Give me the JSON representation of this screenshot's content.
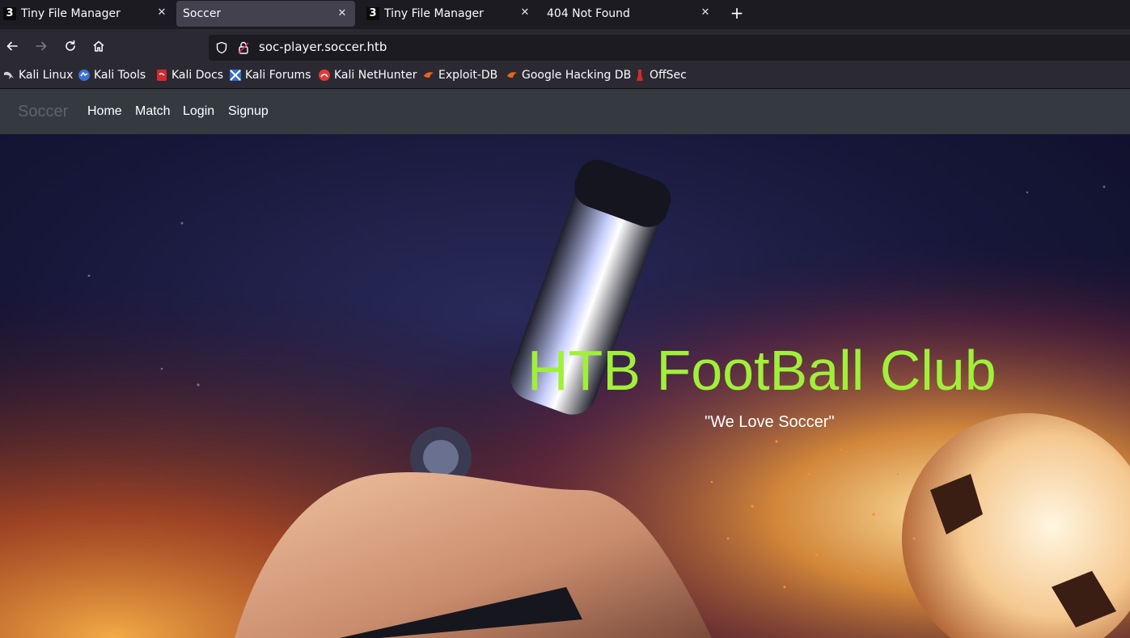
{
  "browser": {
    "tabs": [
      {
        "title": "Tiny File Manager",
        "favicon": "3",
        "active": false
      },
      {
        "title": "Soccer",
        "favicon": "",
        "active": true
      },
      {
        "title": "Tiny File Manager",
        "favicon": "3",
        "active": false
      },
      {
        "title": "404 Not Found",
        "favicon": "",
        "active": false
      }
    ],
    "url": "soc-player.soccer.htb",
    "bookmarks": [
      {
        "label": "Kali Linux",
        "icon": "kali-dragon-icon"
      },
      {
        "label": "Kali Tools",
        "icon": "kali-tools-icon"
      },
      {
        "label": "Kali Docs",
        "icon": "kali-docs-icon"
      },
      {
        "label": "Kali Forums",
        "icon": "kali-forums-icon"
      },
      {
        "label": "Kali NetHunter",
        "icon": "nethunter-icon"
      },
      {
        "label": "Exploit-DB",
        "icon": "exploit-db-icon"
      },
      {
        "label": "Google Hacking DB",
        "icon": "ghdb-icon"
      },
      {
        "label": "OffSec",
        "icon": "offsec-icon"
      }
    ]
  },
  "site": {
    "brand": "Soccer",
    "nav": [
      "Home",
      "Match",
      "Login",
      "Signup"
    ],
    "hero_title": "HTB FootBall Club",
    "hero_subtitle": "\"We Love Soccer\""
  },
  "colors": {
    "hero_title": "#a0f039",
    "site_nav_bg": "#343a40"
  }
}
